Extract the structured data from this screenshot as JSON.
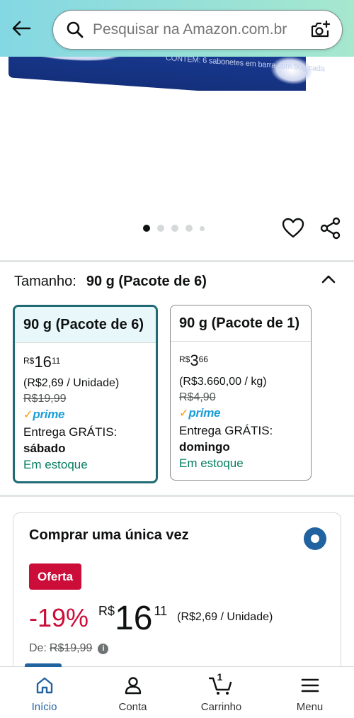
{
  "header": {
    "search_placeholder": "Pesquisar na Amazon.com.br"
  },
  "product_image": {
    "box_text": "CONTÉM: 6 sabonetes em barra com 90g cada",
    "carousel_total": 5,
    "carousel_active": 1
  },
  "size": {
    "label": "Tamanho:",
    "selected_value": "90 g (Pacote de 6)",
    "options": [
      {
        "title": "90 g (Pacote de 6)",
        "currency": "R$",
        "whole": "16",
        "fraction": "11",
        "unit_price": "(R$2,69 / Unidade)",
        "list_price": "R$19,99",
        "prime": "prime",
        "delivery_label": "Entrega GRÁTIS:",
        "delivery_day": "sábado",
        "stock": "Em estoque"
      },
      {
        "title": "90 g (Pacote de 1)",
        "currency": "R$",
        "whole": "3",
        "fraction": "66",
        "unit_price": "(R$3.660,00 / kg)",
        "list_price": "R$4,90",
        "prime": "prime",
        "delivery_label": "Entrega GRÁTIS:",
        "delivery_day": "domingo",
        "stock": "Em estoque"
      }
    ]
  },
  "buy_once": {
    "title": "Comprar uma única vez",
    "badge": "Oferta",
    "discount": "-19%",
    "currency": "R$",
    "whole": "16",
    "fraction": "11",
    "unit_price": "(R$2,69 / Unidade)",
    "was_label": "De:",
    "was_price": "R$19,99"
  },
  "bottom_nav": {
    "items": [
      {
        "label": "Início",
        "icon": "home-icon"
      },
      {
        "label": "Conta",
        "icon": "account-icon"
      },
      {
        "label": "Carrinho",
        "icon": "cart-icon"
      },
      {
        "label": "Menu",
        "icon": "menu-icon"
      }
    ],
    "cart_count": "1"
  },
  "colors": {
    "header_start": "#84d8e3",
    "header_end": "#a6e7ce",
    "selected_border": "#1f6a73",
    "deal_red": "#cc0c39",
    "stock_green": "#067d62",
    "prime_blue": "#1b9ed8",
    "accent_blue": "#2162a1"
  }
}
